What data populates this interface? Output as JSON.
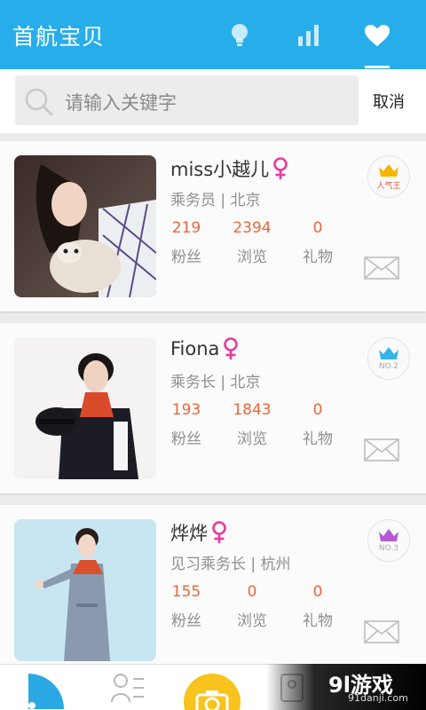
{
  "header": {
    "title": "首航宝贝",
    "tabs": [
      {
        "icon": "lightbulb-icon"
      },
      {
        "icon": "bar-chart-icon"
      },
      {
        "icon": "heart-icon",
        "active": true
      }
    ],
    "accent": "#27aeea"
  },
  "search": {
    "placeholder": "请输入关键字",
    "cancel_label": "取消"
  },
  "cards": [
    {
      "name": "miss小越儿",
      "subtitle": "乘务员 | 北京",
      "stats": [
        {
          "value": "219",
          "label": "粉丝"
        },
        {
          "value": "2394",
          "label": "浏览"
        },
        {
          "value": "0",
          "label": "礼物"
        }
      ],
      "badge": {
        "text": "人气王",
        "crown_color": "#f5b400"
      }
    },
    {
      "name": "Fiona",
      "subtitle": "乘务长 | 北京",
      "stats": [
        {
          "value": "193",
          "label": "粉丝"
        },
        {
          "value": "1843",
          "label": "浏览"
        },
        {
          "value": "0",
          "label": "礼物"
        }
      ],
      "badge": {
        "text": "NO.2",
        "crown_color": "#35b5e8"
      }
    },
    {
      "name": "烨烨",
      "subtitle": "见习乘务长 | 杭州",
      "stats": [
        {
          "value": "155",
          "label": "粉丝"
        },
        {
          "value": "0",
          "label": "浏览"
        },
        {
          "value": "0",
          "label": "礼物"
        }
      ],
      "badge": {
        "text": "NO.3",
        "crown_color": "#b45ad6"
      }
    }
  ],
  "watermark": {
    "text": "9l游戏",
    "sub": "91danji.com"
  }
}
